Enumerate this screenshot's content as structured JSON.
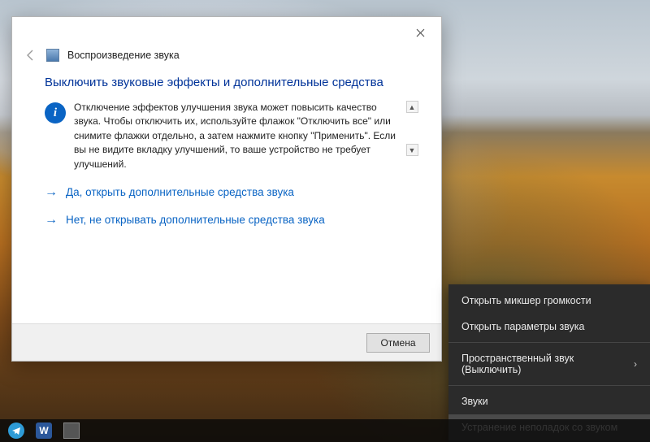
{
  "dialog": {
    "window_title": "Воспроизведение звука",
    "heading": "Выключить звуковые эффекты и дополнительные средства",
    "description": "Отключение эффектов улучшения звука может повысить качество звука. Чтобы отключить их, используйте флажок \"Отключить все\" или снимите флажки отдельно, а затем нажмите кнопку \"Применить\". Если вы не видите вкладку улучшений, то ваше устройство не требует улучшений.",
    "option_yes": "Да, открыть дополнительные средства звука",
    "option_no": "Нет, не открывать дополнительные средства звука",
    "cancel_label": "Отмена"
  },
  "context_menu": {
    "items": [
      {
        "label": "Открыть микшер громкости",
        "submenu": false,
        "highlight": false
      },
      {
        "label": "Открыть параметры звука",
        "submenu": false,
        "highlight": false
      },
      {
        "sep": true
      },
      {
        "label": "Пространственный звук (Выключить)",
        "submenu": true,
        "highlight": false
      },
      {
        "sep": true
      },
      {
        "label": "Звуки",
        "submenu": false,
        "highlight": false
      },
      {
        "label": "Устранение неполадок со звуком",
        "submenu": false,
        "highlight": true
      }
    ]
  },
  "taskbar": {
    "icons": [
      "telegram",
      "word",
      "explorer"
    ]
  }
}
